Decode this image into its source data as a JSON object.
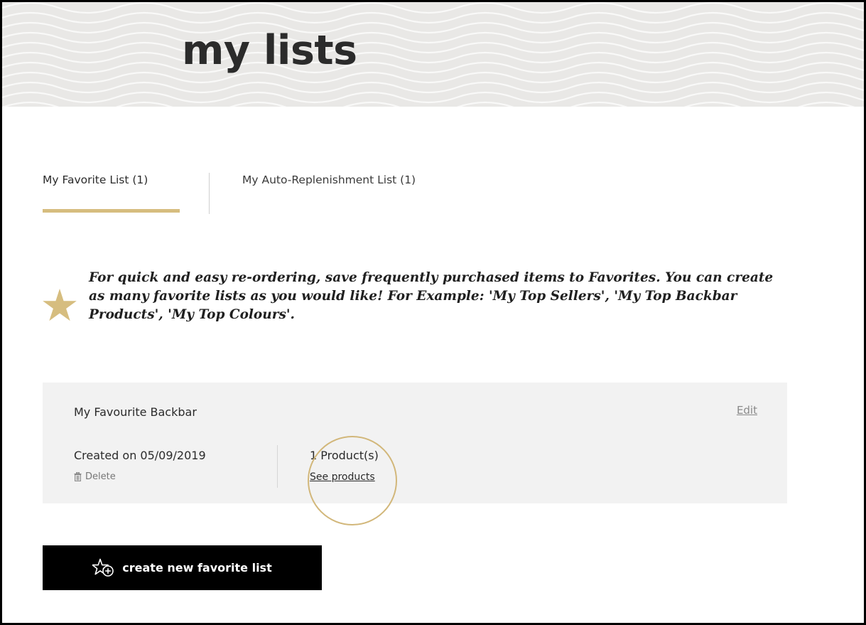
{
  "page": {
    "title": "my lists"
  },
  "tabs": [
    {
      "label": "My Favorite List (1)",
      "active": true
    },
    {
      "label": "My Auto-Replenishment List (1)",
      "active": false
    }
  ],
  "info": {
    "icon": "star-icon",
    "text": "For quick and easy re-ordering, save frequently purchased items to Favorites. You can create as many favorite lists as you would like! For Example: 'My Top Sellers', 'My Top Backbar Products', 'My Top Colours'."
  },
  "list": {
    "name": "My Favourite Backbar",
    "edit_label": "Edit",
    "created": "Created on 05/09/2019",
    "delete_label": "Delete",
    "product_count": "1 Product(s)",
    "see_products_label": "See products"
  },
  "actions": {
    "create_label": "create new favorite list"
  },
  "colors": {
    "accent": "#d6bd7f",
    "button_bg": "#000000",
    "card_bg": "#f2f2f2",
    "hero_bg": "#e9e8e6"
  }
}
